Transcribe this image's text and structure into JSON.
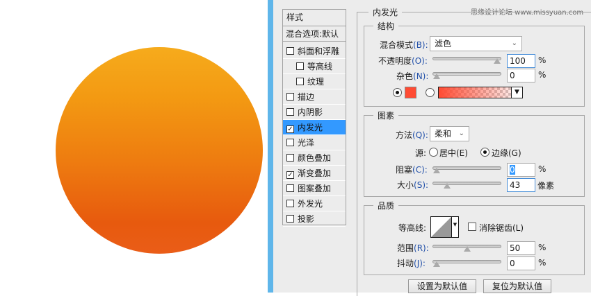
{
  "watermark": "思缘设计论坛 www.missyuan.com",
  "style_list": {
    "header": "样式",
    "blend_options": "混合选项:默认",
    "items": [
      {
        "label": "斜面和浮雕",
        "checked": false,
        "indent": false
      },
      {
        "label": "等高线",
        "checked": false,
        "indent": true
      },
      {
        "label": "纹理",
        "checked": false,
        "indent": true
      },
      {
        "label": "描边",
        "checked": false,
        "indent": false
      },
      {
        "label": "内阴影",
        "checked": false,
        "indent": false
      },
      {
        "label": "内发光",
        "checked": true,
        "indent": false,
        "selected": true
      },
      {
        "label": "光泽",
        "checked": false,
        "indent": false
      },
      {
        "label": "颜色叠加",
        "checked": false,
        "indent": false
      },
      {
        "label": "渐变叠加",
        "checked": true,
        "indent": false
      },
      {
        "label": "图案叠加",
        "checked": false,
        "indent": false
      },
      {
        "label": "外发光",
        "checked": false,
        "indent": false
      },
      {
        "label": "投影",
        "checked": false,
        "indent": false
      }
    ]
  },
  "inner_glow": {
    "title": "内发光",
    "structure": {
      "title": "结构",
      "blend_mode_label": "混合模式",
      "blend_mode_key": "(B):",
      "blend_mode": "滤色",
      "opacity_label": "不透明度",
      "opacity_key": "(O):",
      "opacity": "100",
      "opacity_unit": "%",
      "opacity_fraction": 1.0,
      "noise_label": "杂色",
      "noise_key": "(N):",
      "noise": "0",
      "noise_unit": "%",
      "noise_fraction": 0,
      "color": "#ff4b33"
    },
    "elements": {
      "title": "图素",
      "method_label": "方法",
      "method_key": "(Q):",
      "method": "柔和",
      "source_label": "源:",
      "center_label": "居中(E)",
      "edge_label": "边缘(G)",
      "choke_label": "阻塞",
      "choke_key": "(C):",
      "choke": "0",
      "choke_unit": "%",
      "choke_fraction": 0,
      "size_label": "大小",
      "size_key": "(S):",
      "size": "43",
      "size_unit": "像素",
      "size_fraction": 0.17
    },
    "quality": {
      "title": "品质",
      "contour_label": "等高线:",
      "anti_alias_label": "消除锯齿(L)",
      "range_label": "范围",
      "range_key": "(R):",
      "range": "50",
      "range_unit": "%",
      "range_fraction": 0.5,
      "jitter_label": "抖动",
      "jitter_key": "(J):",
      "jitter": "0",
      "jitter_unit": "%",
      "jitter_fraction": 0
    },
    "make_default": "设置为默认值",
    "reset_default": "复位为默认值"
  }
}
